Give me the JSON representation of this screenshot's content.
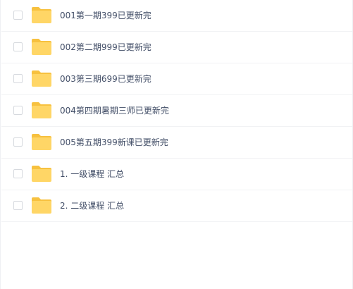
{
  "file_list": {
    "items": [
      {
        "name": "001第一期399已更新完",
        "type": "folder",
        "icon": "folder-icon",
        "checked": false
      },
      {
        "name": "002第二期999已更新完",
        "type": "folder",
        "icon": "folder-icon",
        "checked": false
      },
      {
        "name": "003第三期699已更新完",
        "type": "folder",
        "icon": "folder-icon",
        "checked": false
      },
      {
        "name": "004第四期暑期三师已更新完",
        "type": "folder",
        "icon": "folder-icon",
        "checked": false
      },
      {
        "name": "005第五期399新课已更新完",
        "type": "folder",
        "icon": "folder-icon",
        "checked": false
      },
      {
        "name": "1. 一级课程 汇总",
        "type": "folder",
        "icon": "folder-icon",
        "checked": false
      },
      {
        "name": "2. 二级课程 汇总",
        "type": "folder",
        "icon": "folder-icon",
        "checked": false
      }
    ]
  },
  "colors": {
    "folder_body": "#ffd666",
    "folder_tab": "#f7c13f",
    "text": "#424e67",
    "divider": "#f1f2f4",
    "checkbox_border": "#d6d9de"
  }
}
